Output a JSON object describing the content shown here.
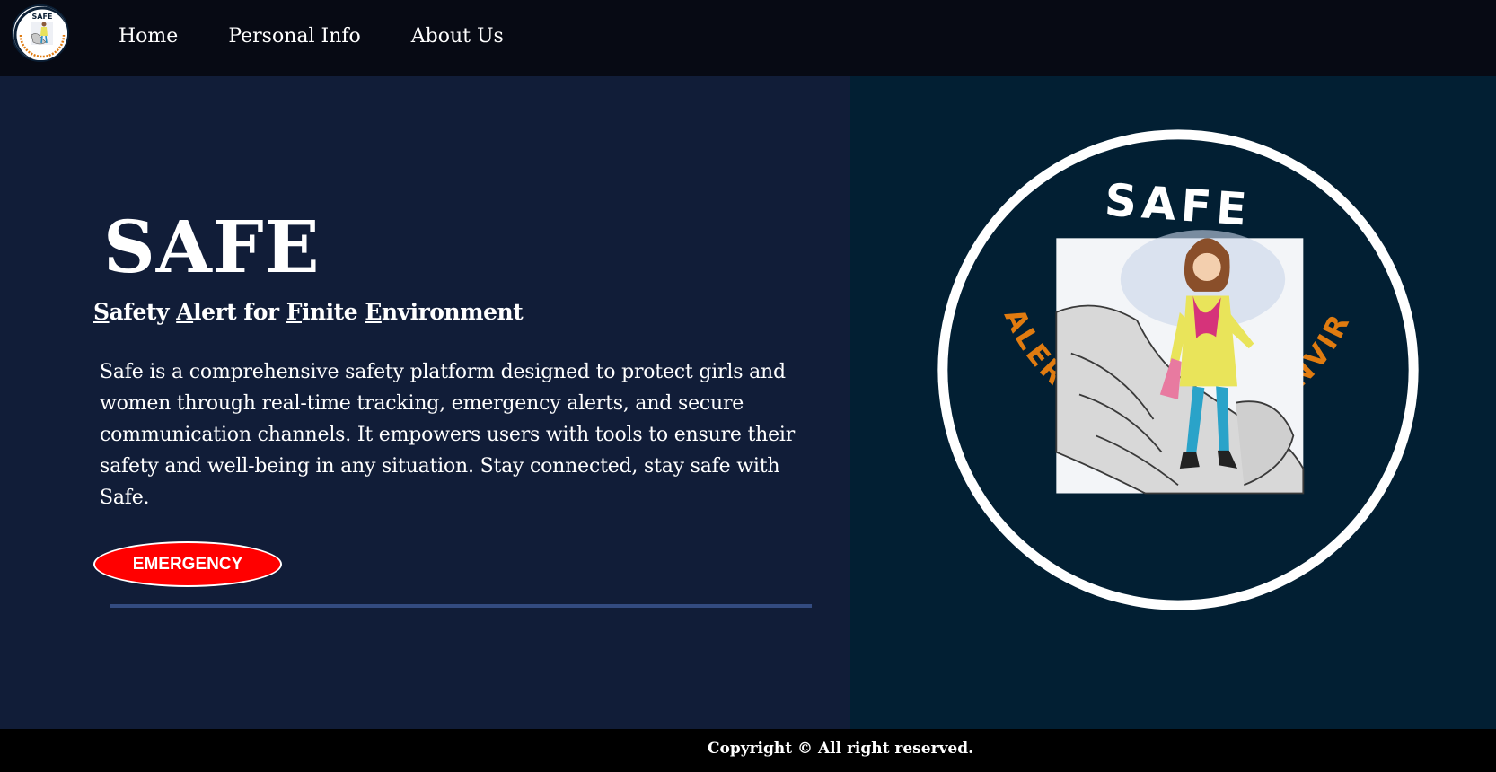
{
  "nav": {
    "logo_alt": "SAFE logo",
    "links": [
      {
        "label": "Home"
      },
      {
        "label": "Personal Info"
      },
      {
        "label": "About Us"
      }
    ]
  },
  "hero": {
    "title": "SAFE",
    "subtitle": {
      "parts": [
        {
          "initial": "S",
          "rest": "afety "
        },
        {
          "initial": "A",
          "rest": "lert for "
        },
        {
          "initial": "F",
          "rest": "inite "
        },
        {
          "initial": "E",
          "rest": "nvironment"
        }
      ]
    },
    "description": "Safe is a comprehensive safety platform designed to protect girls and women through real-time tracking, emergency alerts, and secure communication channels. It empowers users with tools to ensure their safety and well-being in any situation. Stay connected, stay safe with Safe.",
    "emergency_label": "EMERGENCY"
  },
  "emblem": {
    "top_text": "SAFE",
    "ring_text": "SAFETY ALERT FOR FINITE ENVIRONMENT",
    "ring_color": "#e07b10"
  },
  "footer": {
    "copyright": "Copyright © All right reserved."
  },
  "colors": {
    "nav_bg": "#070a14",
    "left_bg": "#111d38",
    "right_bg": "#021f33",
    "emergency": "#ff0000",
    "divider": "#334b80"
  }
}
